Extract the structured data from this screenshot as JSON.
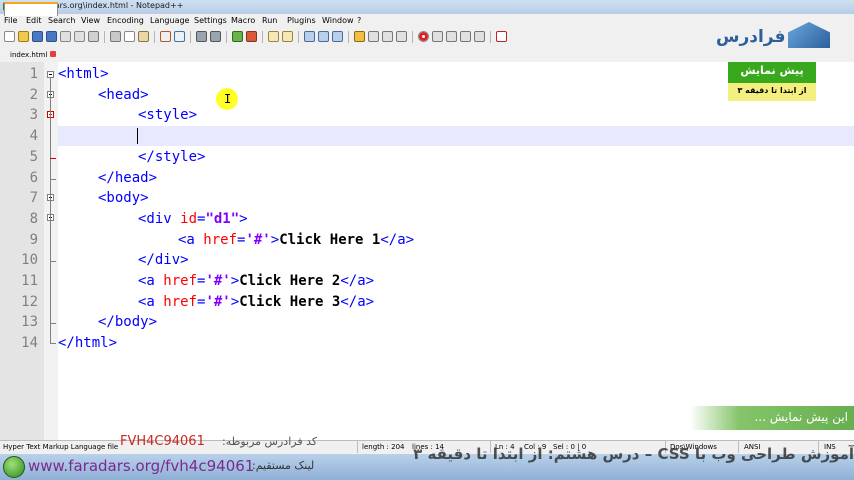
{
  "window": {
    "title": "*D:\\FaraDars.org\\index.html - Notepad++"
  },
  "menu": [
    "File",
    "Edit",
    "Search",
    "View",
    "Encoding",
    "Language",
    "Settings",
    "Macro",
    "Run",
    "Plugins",
    "Window",
    "?"
  ],
  "tab": {
    "label": "index.html"
  },
  "editor": {
    "line_numbers": [
      "1",
      "2",
      "3",
      "4",
      "5",
      "6",
      "7",
      "8",
      "9",
      "10",
      "11",
      "12",
      "13",
      "14"
    ],
    "lines": [
      [
        {
          "t": "tag",
          "v": "<html>"
        }
      ],
      [
        {
          "t": "tag",
          "v": "<head>"
        }
      ],
      [
        {
          "t": "tag",
          "v": "<style>"
        }
      ],
      [],
      [
        {
          "t": "tag",
          "v": "</style>"
        }
      ],
      [
        {
          "t": "tag",
          "v": "</head>"
        }
      ],
      [
        {
          "t": "tag",
          "v": "<body>"
        }
      ],
      [
        {
          "t": "tag",
          "v": "<div "
        },
        {
          "t": "attr",
          "v": "id"
        },
        {
          "t": "tag",
          "v": "="
        },
        {
          "t": "val",
          "v": "\"d1\""
        },
        {
          "t": "tag",
          "v": ">"
        }
      ],
      [
        {
          "t": "tag",
          "v": "<a "
        },
        {
          "t": "attr",
          "v": "href"
        },
        {
          "t": "tag",
          "v": "="
        },
        {
          "t": "val",
          "v": "'#'"
        },
        {
          "t": "tag",
          "v": ">"
        },
        {
          "t": "txt",
          "v": "Click Here 1"
        },
        {
          "t": "tag",
          "v": "</a>"
        }
      ],
      [
        {
          "t": "tag",
          "v": "</div>"
        }
      ],
      [
        {
          "t": "tag",
          "v": "<a "
        },
        {
          "t": "attr",
          "v": "href"
        },
        {
          "t": "tag",
          "v": "="
        },
        {
          "t": "val",
          "v": "'#'"
        },
        {
          "t": "tag",
          "v": ">"
        },
        {
          "t": "txt",
          "v": "Click Here 2"
        },
        {
          "t": "tag",
          "v": "</a>"
        }
      ],
      [
        {
          "t": "tag",
          "v": "<a "
        },
        {
          "t": "attr",
          "v": "href"
        },
        {
          "t": "tag",
          "v": "="
        },
        {
          "t": "val",
          "v": "'#'"
        },
        {
          "t": "tag",
          "v": ">"
        },
        {
          "t": "txt",
          "v": "Click Here 3"
        },
        {
          "t": "tag",
          "v": "</a>"
        }
      ],
      [
        {
          "t": "tag",
          "v": "</body>"
        }
      ],
      [
        {
          "t": "tag",
          "v": "</html>"
        }
      ]
    ]
  },
  "overlay": {
    "logo_text": "فرادرس",
    "preview_badge": "پیش نمایش",
    "preview_sub": "از ابتدا تا دقیقه ۳",
    "ribbon_text": "این پیش نمایش ..."
  },
  "status": {
    "language": "Hyper Text Markup Language file",
    "length": "length : 204",
    "lines": "lines : 14",
    "ln": "Ln : 4",
    "col": "Col : 9",
    "sel": "Sel : 0 | 0",
    "eol": "Dos\\Windows",
    "encoding": "ANSI",
    "mode": "INS"
  },
  "footer": {
    "course_code": "FVH4C94061",
    "course_code_label": "کد فرادرس مربوطه:",
    "site_url": "www.faradars.org/fvh4c94061",
    "link_label": "لینک مستقیم:",
    "course_title": "آموزش طراحی وب با CSS – درس هشتم: از ابتدا تا دقیقه ۳"
  },
  "colors": {
    "tag": "#0000ff",
    "attr": "#ff0000",
    "value": "#8000ff",
    "accent_green": "#38a81c"
  }
}
